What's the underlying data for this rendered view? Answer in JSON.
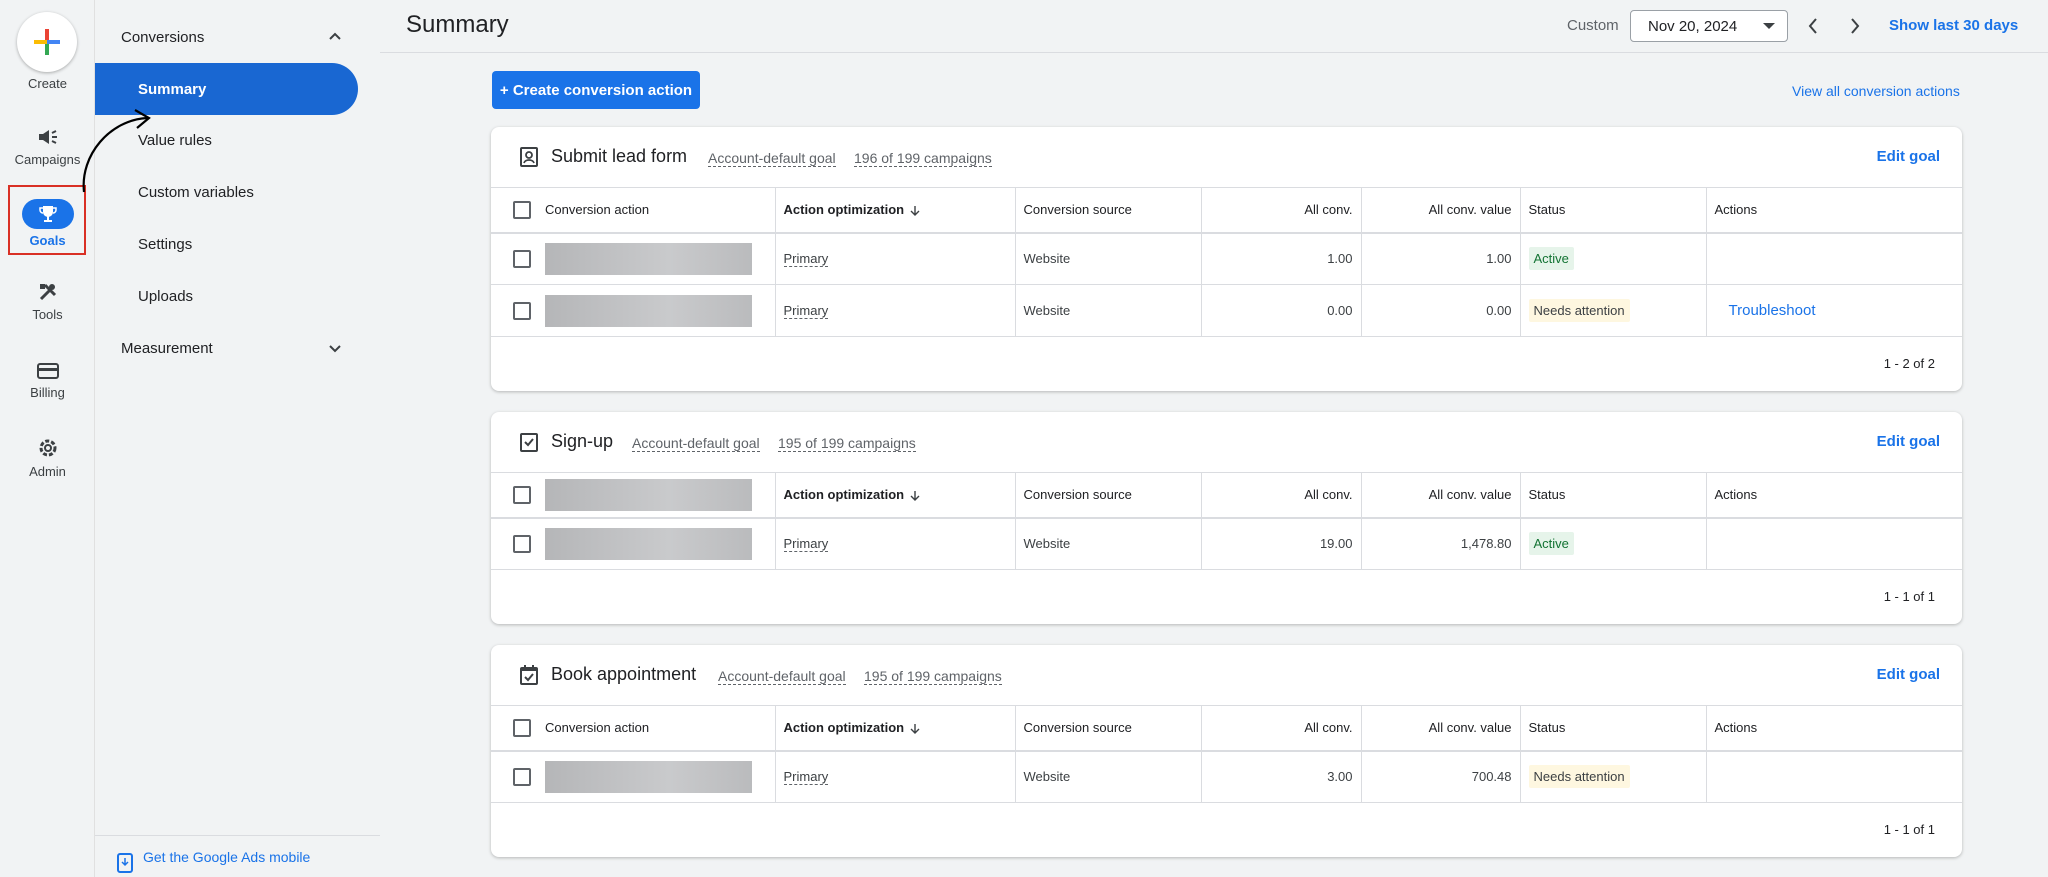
{
  "rail": {
    "create": "Create",
    "items": [
      {
        "label": "Campaigns",
        "icon": "megaphone-icon"
      },
      {
        "label": "Goals",
        "icon": "trophy-icon"
      },
      {
        "label": "Tools",
        "icon": "tools-icon"
      },
      {
        "label": "Billing",
        "icon": "credit-card-icon"
      },
      {
        "label": "Admin",
        "icon": "gear-icon"
      }
    ]
  },
  "subnav": {
    "conversions": "Conversions",
    "items": [
      "Summary",
      "Value rules",
      "Custom variables",
      "Settings",
      "Uploads"
    ],
    "measurement": "Measurement",
    "mobile_link": "Get the Google Ads mobile"
  },
  "header": {
    "title": "Summary",
    "custom_label": "Custom",
    "date": "Nov 20, 2024",
    "show_last": "Show last 30 days",
    "create_action": "+ Create conversion action",
    "view_all": "View all conversion actions"
  },
  "columns": {
    "conversion_action": "Conversion action",
    "action_optimization": "Action optimization",
    "conversion_source": "Conversion source",
    "all_conv": "All conv.",
    "all_conv_value": "All conv. value",
    "status": "Status",
    "actions": "Actions"
  },
  "edit_goal": "Edit goal",
  "goals": [
    {
      "name": "Submit lead form",
      "default": "Account-default goal",
      "campaigns": "196 of 199 campaigns",
      "pager": "1 - 2 of 2",
      "rows": [
        {
          "optimization": "Primary",
          "source": "Website",
          "conv": "1.00",
          "value": "1.00",
          "status": "Active",
          "action": ""
        },
        {
          "optimization": "Primary",
          "source": "Website",
          "conv": "0.00",
          "value": "0.00",
          "status": "Needs attention",
          "action": "Troubleshoot"
        }
      ]
    },
    {
      "name": "Sign-up",
      "default": "Account-default goal",
      "campaigns": "195 of 199 campaigns",
      "pager": "1 - 1 of 1",
      "rows": [
        {
          "optimization": "Primary",
          "source": "Website",
          "conv": "19.00",
          "value": "1,478.80",
          "status": "Active",
          "action": ""
        }
      ]
    },
    {
      "name": "Book appointment",
      "default": "Account-default goal",
      "campaigns": "195 of 199 campaigns",
      "pager": "1 - 1 of 1",
      "rows": [
        {
          "optimization": "Primary",
          "source": "Website",
          "conv": "3.00",
          "value": "700.48",
          "status": "Needs attention",
          "action": ""
        }
      ]
    }
  ],
  "colors": {
    "accent": "#1a73e8",
    "highlight_box": "#d93025",
    "active": "#137333"
  }
}
